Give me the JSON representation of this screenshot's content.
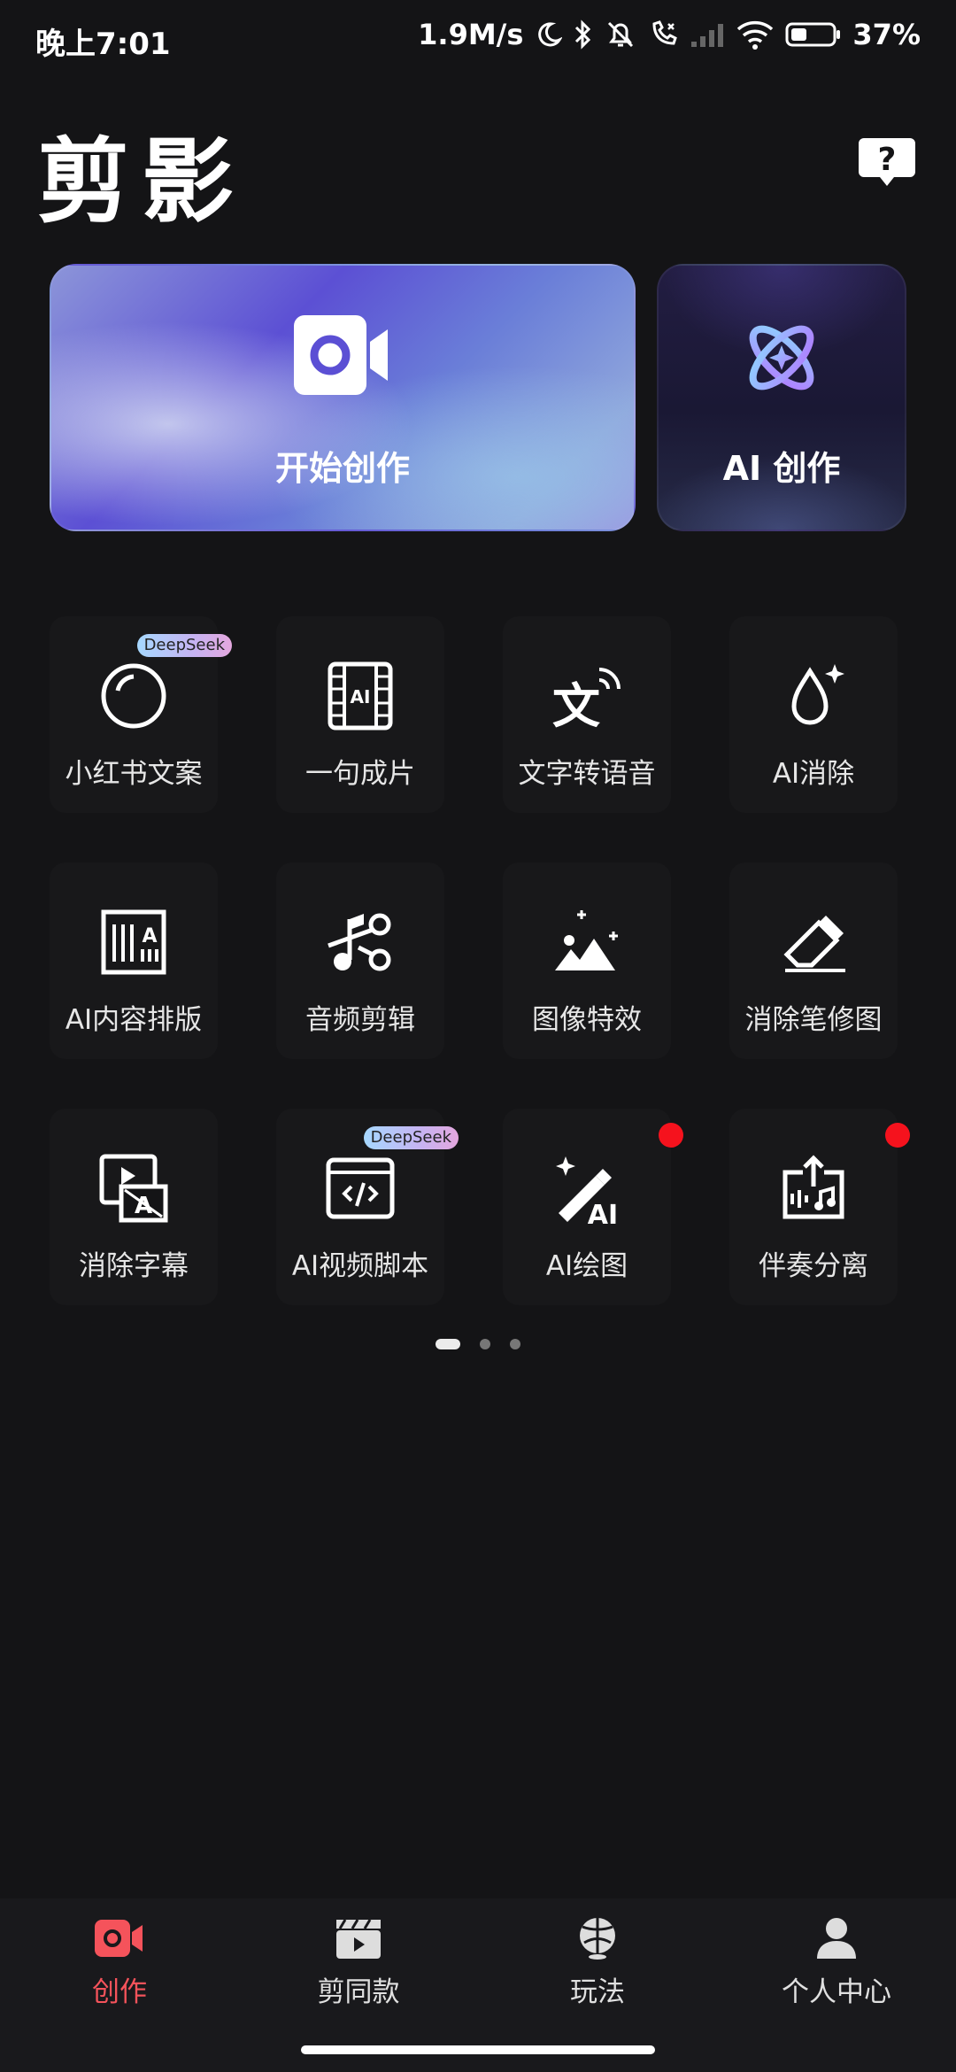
{
  "status": {
    "time": "晚上7:01",
    "network_speed": "1.9M/s",
    "battery": "37%",
    "icons": [
      "moon-icon",
      "bluetooth-icon",
      "bell-off-icon",
      "call-icon",
      "signal-icon",
      "wifi-icon",
      "battery-icon"
    ]
  },
  "header": {
    "title": "剪影",
    "help_icon": "help-bubble-icon"
  },
  "hero": {
    "start": {
      "label": "开始创作",
      "icon": "video-camera-icon"
    },
    "ai": {
      "label": "AI 创作",
      "icon": "atom-icon"
    }
  },
  "tools": [
    {
      "label": "小红书文案",
      "icon": "circle-icon",
      "badge": "DeepSeek"
    },
    {
      "label": "一句成片",
      "icon": "ai-film-icon"
    },
    {
      "label": "文字转语音",
      "icon": "text-to-speech-icon"
    },
    {
      "label": "AI消除",
      "icon": "drop-sparkle-icon"
    },
    {
      "label": "AI内容排版",
      "icon": "layout-icon"
    },
    {
      "label": "音频剪辑",
      "icon": "audio-scissors-icon"
    },
    {
      "label": "图像特效",
      "icon": "image-effect-icon"
    },
    {
      "label": "消除笔修图",
      "icon": "eraser-icon"
    },
    {
      "label": "消除字幕",
      "icon": "subtitle-remove-icon"
    },
    {
      "label": "AI视频脚本",
      "icon": "code-window-icon",
      "badge": "DeepSeek"
    },
    {
      "label": "AI绘图",
      "icon": "magic-wand-icon",
      "dot": true
    },
    {
      "label": "伴奏分离",
      "icon": "audio-split-icon",
      "dot": true
    }
  ],
  "pager": {
    "pages": 3,
    "current": 1
  },
  "nav": [
    {
      "label": "创作",
      "icon": "camera-nav-icon",
      "active": true
    },
    {
      "label": "剪同款",
      "icon": "clapboard-icon"
    },
    {
      "label": "玩法",
      "icon": "ball-icon"
    },
    {
      "label": "个人中心",
      "icon": "person-icon"
    }
  ],
  "colors": {
    "accent": "#f5535b",
    "background": "#141416",
    "red_dot": "#f5121d"
  }
}
